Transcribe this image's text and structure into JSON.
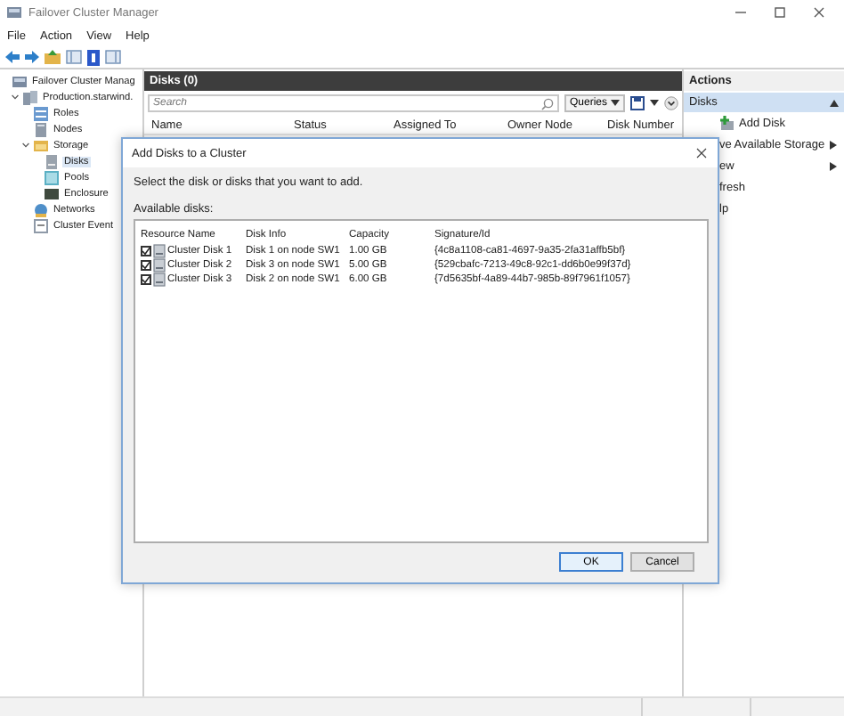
{
  "window": {
    "title": "Failover Cluster Manager"
  },
  "menu": [
    "File",
    "Action",
    "View",
    "Help"
  ],
  "tree": [
    {
      "label": "Failover Cluster Manag",
      "kind": "manager",
      "selected": false,
      "children": [
        {
          "label": "Production.starwind.",
          "kind": "cluster",
          "selected": false,
          "expanded": true,
          "children": [
            {
              "label": "Roles",
              "kind": "roles",
              "selected": false
            },
            {
              "label": "Nodes",
              "kind": "nodes",
              "selected": false
            },
            {
              "label": "Storage",
              "kind": "storage",
              "selected": false,
              "expanded": true,
              "children": [
                {
                  "label": "Disks",
                  "kind": "disks",
                  "selected": true
                },
                {
                  "label": "Pools",
                  "kind": "pools",
                  "selected": false
                },
                {
                  "label": "Enclosure",
                  "kind": "enclosures",
                  "selected": false
                }
              ]
            },
            {
              "label": "Networks",
              "kind": "networks",
              "selected": false
            },
            {
              "label": "Cluster Event",
              "kind": "events",
              "selected": false
            }
          ]
        }
      ]
    }
  ],
  "panel": {
    "title": "Disks (0)",
    "search_placeholder": "Search",
    "queries_label": "Queries",
    "columns": [
      "Name",
      "Status",
      "Assigned To",
      "Owner Node",
      "Disk Number"
    ]
  },
  "actions": {
    "title": "Actions",
    "section": {
      "label": "Disks",
      "expanded": true
    },
    "items": [
      {
        "label": "Add Disk",
        "kind": "add"
      },
      {
        "label": "ve Available Storage",
        "kind": "submenu"
      },
      {
        "label": "ew",
        "kind": "submenu"
      },
      {
        "label": "fresh",
        "kind": "plain"
      },
      {
        "label": "lp",
        "kind": "plain"
      }
    ]
  },
  "dialog": {
    "title": "Add Disks to a Cluster",
    "instruction": "Select the disk or disks that you want to add.",
    "list_label": "Available disks:",
    "columns": [
      "Resource Name",
      "Disk Info",
      "Capacity",
      "Signature/Id"
    ],
    "rows": [
      {
        "name": "Cluster Disk 1",
        "disk_info": "Disk 1 on node SW1",
        "capacity": "1.00 GB",
        "signature": "{4c8a1108-ca81-4697-9a35-2fa31affb5bf}",
        "checked": true
      },
      {
        "name": "Cluster Disk 2",
        "disk_info": "Disk 3 on node SW1",
        "capacity": "5.00 GB",
        "signature": "{529cbafc-7213-49c8-92c1-dd6b0e99f37d}",
        "checked": true
      },
      {
        "name": "Cluster Disk 3",
        "disk_info": "Disk 2 on node SW1",
        "capacity": "6.00 GB",
        "signature": "{7d5635bf-4a89-44b7-985b-89f7961f1057}",
        "checked": true
      }
    ],
    "buttons": [
      {
        "label": "OK",
        "default": true
      },
      {
        "label": "Cancel",
        "default": false
      }
    ]
  }
}
